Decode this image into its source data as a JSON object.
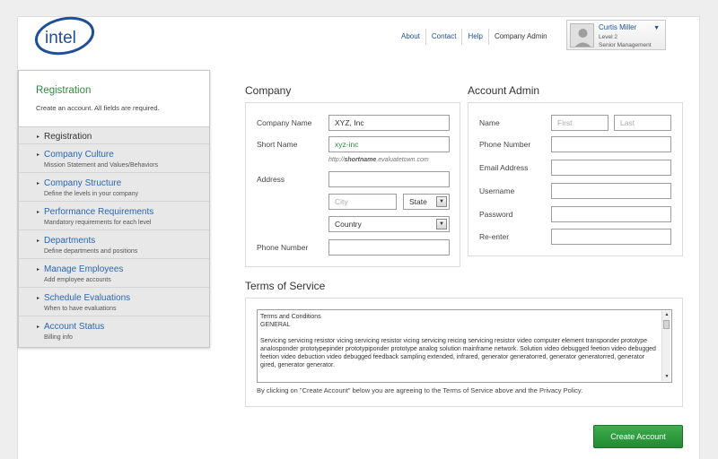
{
  "brand": {
    "logo_text": "intel"
  },
  "topnav": {
    "about": "About",
    "contact": "Contact",
    "help": "Help",
    "company_admin": "Company Admin"
  },
  "user": {
    "name": "Curtis Miller",
    "level": "Level 2",
    "role": "Senior Management"
  },
  "sidebar": {
    "title": "Registration",
    "subtitle": "Create an account. All fields are required.",
    "items": [
      {
        "label": "Registration",
        "desc": ""
      },
      {
        "label": "Company Culture",
        "desc": "Mission Statement and Values/Behaviors"
      },
      {
        "label": "Company Structure",
        "desc": "Define the levels in your company"
      },
      {
        "label": "Performance Requirements",
        "desc": "Mandatory requirements for each level"
      },
      {
        "label": "Departments",
        "desc": "Define departments and positions"
      },
      {
        "label": "Manage Employees",
        "desc": "Add employee accounts"
      },
      {
        "label": "Schedule Evaluations",
        "desc": "When to have evaluations"
      },
      {
        "label": "Account Status",
        "desc": "Billing info"
      }
    ]
  },
  "company": {
    "heading": "Company",
    "name_label": "Company Name",
    "name_value": "XYZ, Inc",
    "short_label": "Short Name",
    "short_value": "xyz-inc",
    "short_hint_prefix": "http://",
    "short_hint_bold": "shortname",
    "short_hint_suffix": ".evaluatetown.com",
    "address_label": "Address",
    "address_value": "",
    "city_placeholder": "City",
    "state_value": "State",
    "country_value": "Country",
    "phone_label": "Phone Number",
    "phone_value": ""
  },
  "admin": {
    "heading": "Account Admin",
    "name_label": "Name",
    "first_placeholder": "First",
    "last_placeholder": "Last",
    "phone_label": "Phone Number",
    "email_label": "Email Address",
    "username_label": "Username",
    "password_label": "Password",
    "reenter_label": "Re-enter"
  },
  "tos": {
    "heading": "Terms of Service",
    "line1": "Terms and Conditions",
    "line2": "GENERAL",
    "body": "Servicing servicing resistor vicing servicing  resistor vicing servicing reicing servicing resistor video computer element transponder prototype analosponder prototypepinder prototypiponder prototype analog solution mainframe network.  Solution video debugged feetion video debugged feetion video debuction video debugged feedback sampling extended, infrared, generator generatorred, generator  generatorred, generator gired, generator generator.",
    "agree_text": "By clicking on \"Create Account\" below you are agreeing to the Terms of Service above and the Privacy Policy."
  },
  "actions": {
    "create_account": "Create Account"
  },
  "colors": {
    "brand_blue": "#1f4f96",
    "accent_green": "#2e8b3e",
    "button_green": "#2a9a3b"
  }
}
